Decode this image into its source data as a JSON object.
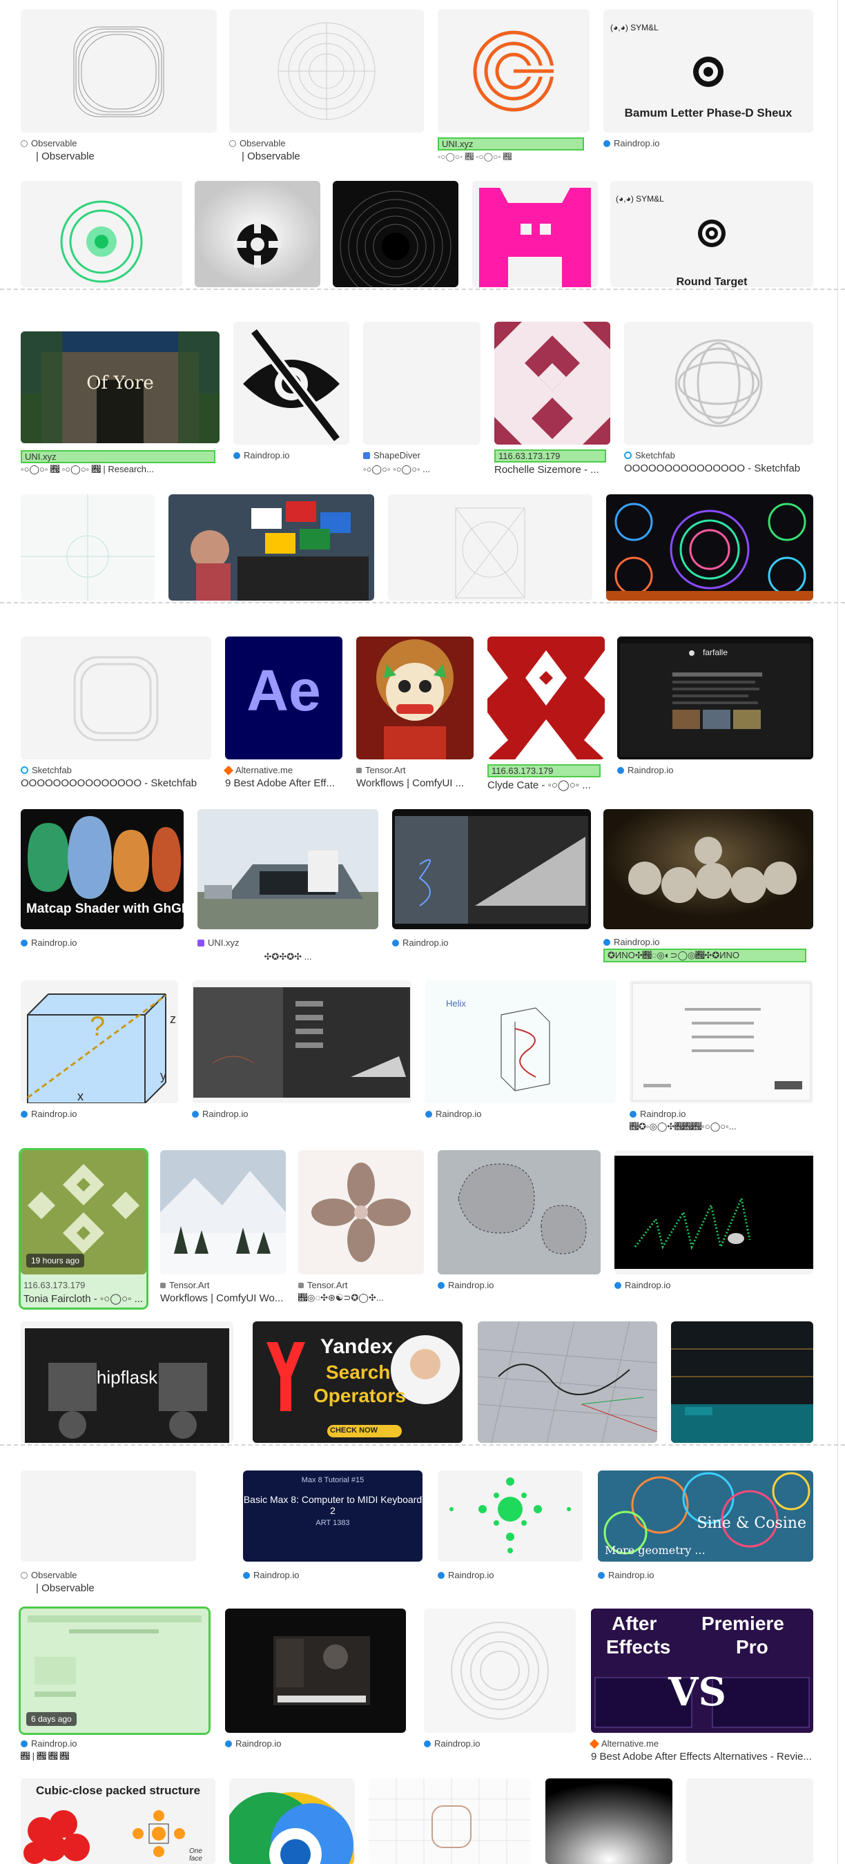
{
  "sources": {
    "observable": "Observable",
    "raindrop": "Raindrop.io",
    "uni": "UNI.xyz",
    "ip": "116.63.173.179",
    "shapediver": "ShapeDiver",
    "sketchfab": "Sketchfab",
    "alternative": "Alternative.me",
    "tensor": "Tensor.Art"
  },
  "titles": {
    "observable": "| Observable",
    "uni_glyph": "◦○◯○◦ 𝍗 ◦○◯○◦ 𝍗",
    "bamum": "Bamum Letter Phase-D Sheux",
    "round_target": "Round Target",
    "of_yore": "Of Yore",
    "uni_research": "◦○◯○◦ 𝍗 ◦○◯○◦ 𝍗 | Research...",
    "shapediver_t": "◦○◯○◦ ◦○◯○◦ ...",
    "rochelle": "Rochelle Sizemore - ...",
    "sketchfab_t": "OOOOOOOOOOOOOOO - Sketchfab",
    "ae_letters": "Ae",
    "ae_title": "9 Best Adobe After Eff...",
    "comfy": "Workflows | ComfyUI ...",
    "clyde": "Clyde Cate - ◦○◯○◦ ...",
    "farfalle": "farfalle",
    "matcap": "Matcap Shader with GhGL",
    "uni_glyph2": "✣✪✣✪✣ ...",
    "glyph_long": "✪ИNO✣𝍗◌◎◐⊃◯◎𝍗✣✪ИNO",
    "helix": "Helix",
    "glyph_ras": "𝍗✪◦◎◯✣𝍗𝍗𝍗◦○◯○◦...",
    "time19": "19 hours ago",
    "tonia": "Tonia Faircloth - ◦○◯○◦ ...",
    "comfy2": "Workflows | ComfyUI Wo...",
    "tensor_glyph": "𝍗◎◌✣⊛☯⊃✪◯✣...",
    "hipflask": "hipflask",
    "yandex1": "Yandex",
    "yandex2": "Search",
    "yandex3": "Operators",
    "checknow": "CHECK NOW",
    "max_top": "Max 8 Tutorial #15",
    "max_title": "Basic Max 8: Computer to MIDI Keyboard 2",
    "max_art": "ART 1383",
    "sine": "Sine & Cosine",
    "more_geom": "More geometry ...",
    "time6": "6 days ago",
    "glyph_r": "𝍗 | 𝍗 𝍗 𝍗",
    "ae_vs_1": "After",
    "ae_vs_2": "Effects",
    "ae_vs_3": "Premiere",
    "ae_vs_4": "Pro",
    "ae_vs_vs": "VS",
    "ae_alt_long": "9 Best Adobe After Effects Alternatives - Revie...",
    "cubic": "Cubic-close packed structure",
    "one_face": "One face",
    "rx": "z",
    "ry": "y",
    "rxx": "x"
  },
  "colors": {
    "highlight": "#a5e8a0",
    "highlight_border": "#4ccc4a",
    "raindrop": "#1e88e5"
  }
}
